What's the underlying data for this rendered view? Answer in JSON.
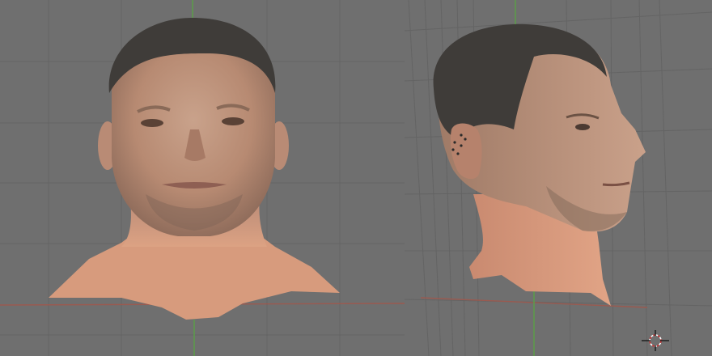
{
  "viewports": [
    {
      "name": "front-view",
      "model": "head-front"
    },
    {
      "name": "side-view",
      "model": "head-side"
    }
  ],
  "colors": {
    "background": "#6f6f6f",
    "grid_line": "#646464",
    "axis_x": "#9a5a50",
    "axis_y": "#5c9a4c",
    "skin": "#d79b7d",
    "hair": "#3f3c39"
  },
  "icons": [
    "3d-cursor-icon"
  ]
}
